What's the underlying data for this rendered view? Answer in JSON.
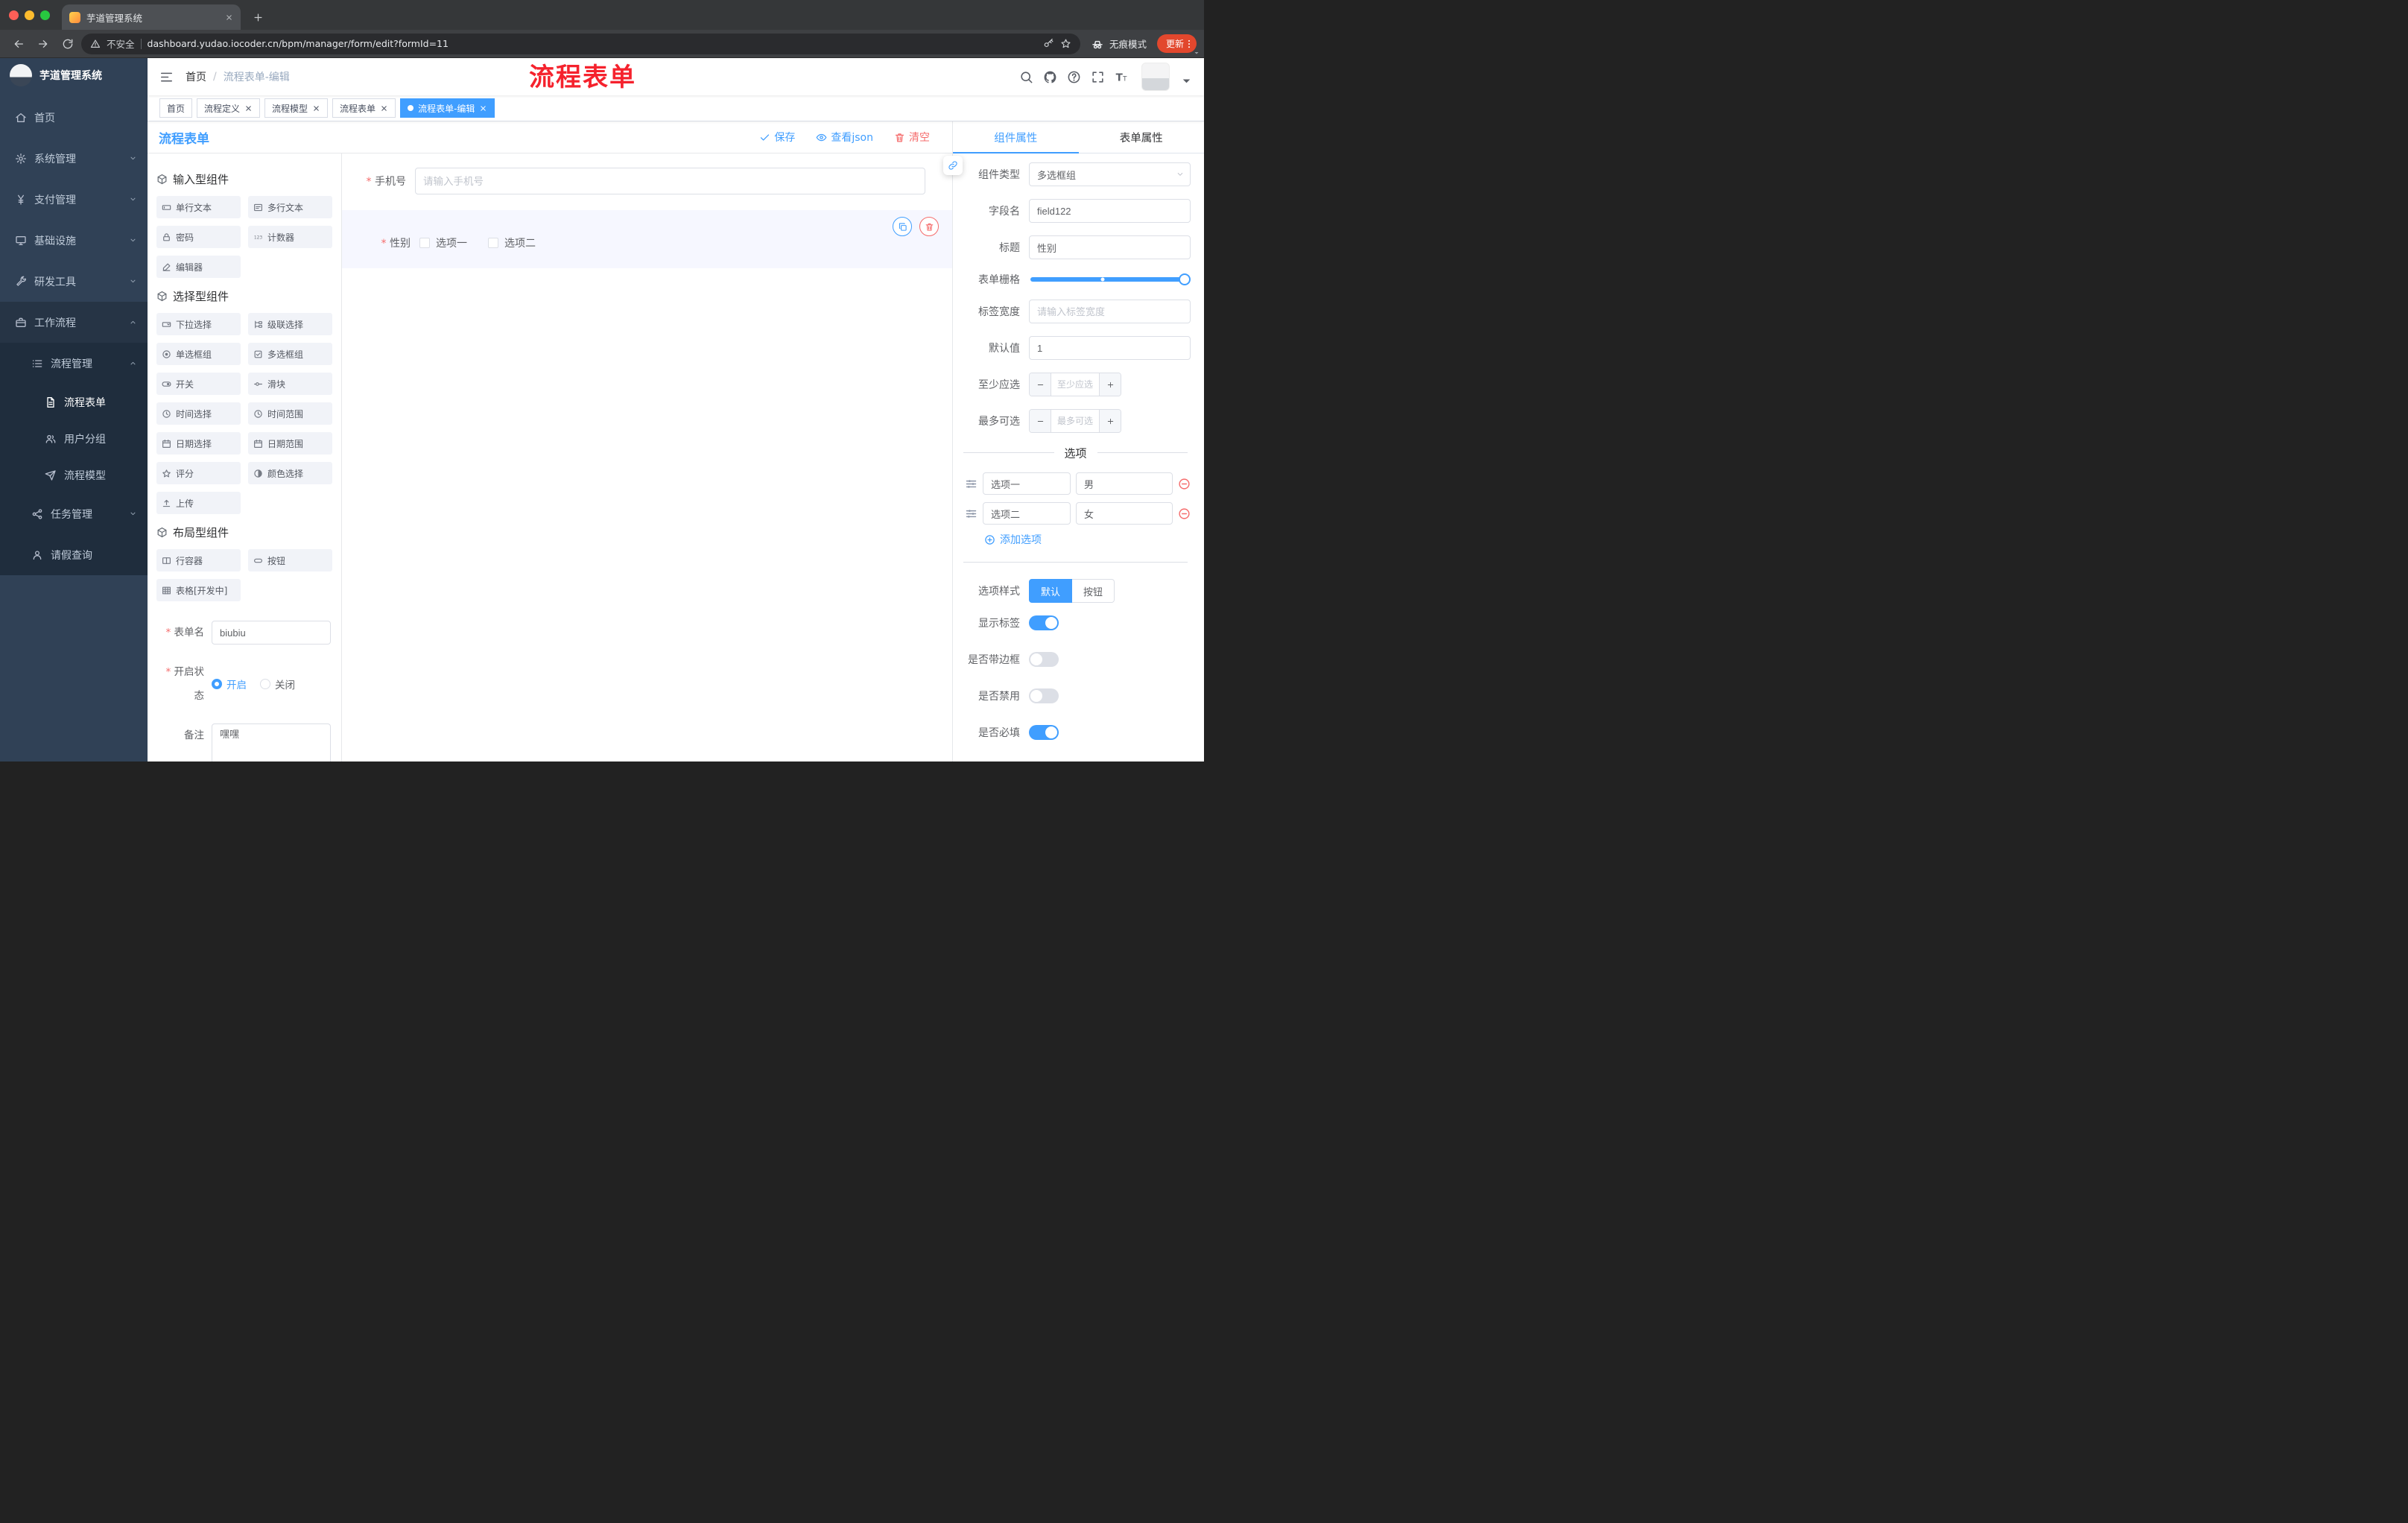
{
  "theme": {
    "accent": "#409eff",
    "danger": "#f56c6c",
    "annotation": "#f5222d",
    "sidebar-bg": "#304156",
    "submenu-bg": "#1f2d3d",
    "submenu-open-bg": "#263445",
    "selected-bg": "#f6f7ff",
    "update-btn": "#e2472d",
    "tab-active-bg": "#4d5054"
  },
  "annotation": {
    "text": "流程表单"
  },
  "browser": {
    "tab_title": "芋道管理系统",
    "security_label": "不安全",
    "url": "dashboard.yudao.iocoder.cn/bpm/manager/form/edit?formId=11",
    "incognito_label": "无痕模式",
    "update_button": "更新"
  },
  "sidebar": {
    "logo_title": "芋道管理系统",
    "menu": [
      {
        "name": "home",
        "label": "首页",
        "icon": "home",
        "level": 1
      },
      {
        "name": "system",
        "label": "系统管理",
        "icon": "gear",
        "level": 1,
        "chevron": "down"
      },
      {
        "name": "payment",
        "label": "支付管理",
        "icon": "yen",
        "level": 1,
        "chevron": "down"
      },
      {
        "name": "infrastructure",
        "label": "基础设施",
        "icon": "monitor",
        "level": 1,
        "chevron": "down"
      },
      {
        "name": "devtools",
        "label": "研发工具",
        "icon": "tools",
        "level": 1,
        "chevron": "down"
      },
      {
        "name": "workflow",
        "label": "工作流程",
        "icon": "briefcase",
        "level": 1,
        "chevron": "up",
        "opened": true
      },
      {
        "name": "process-mgmt",
        "label": "流程管理",
        "icon": "list",
        "level": 2,
        "chevron": "up",
        "sub": true
      },
      {
        "name": "process-form",
        "label": "流程表单",
        "icon": "document",
        "level": 3,
        "sub": true,
        "active": true
      },
      {
        "name": "user-group",
        "label": "用户分组",
        "icon": "users",
        "level": 3,
        "sub": true
      },
      {
        "name": "process-model",
        "label": "流程模型",
        "icon": "send",
        "level": 3,
        "sub": true
      },
      {
        "name": "task-mgmt",
        "label": "任务管理",
        "icon": "share",
        "level": 2,
        "chevron": "down",
        "sub": true
      },
      {
        "name": "leave-query",
        "label": "请假查询",
        "icon": "user",
        "level": 2,
        "sub": true
      }
    ]
  },
  "header": {
    "breadcrumb": [
      "首页",
      "流程表单-编辑"
    ],
    "separator": "/"
  },
  "tags_view": [
    {
      "label": "首页",
      "closable": false,
      "active": false
    },
    {
      "label": "流程定义",
      "closable": true,
      "active": false
    },
    {
      "label": "流程模型",
      "closable": true,
      "active": false
    },
    {
      "label": "流程表单",
      "closable": true,
      "active": false
    },
    {
      "label": "流程表单-编辑",
      "closable": true,
      "active": true
    }
  ],
  "editor": {
    "panel_title": "流程表单",
    "actions": {
      "save": "保存",
      "view_json": "查看json",
      "clear": "清空"
    }
  },
  "component_library": {
    "groups": [
      {
        "title": "输入型组件",
        "icon": "cube",
        "items": [
          {
            "name": "single-line-text",
            "label": "单行文本",
            "icon": "input"
          },
          {
            "name": "multi-line-text",
            "label": "多行文本",
            "icon": "textarea"
          },
          {
            "name": "password",
            "label": "密码",
            "icon": "lock"
          },
          {
            "name": "counter",
            "label": "计数器",
            "icon": "counter"
          },
          {
            "name": "editor",
            "label": "编辑器",
            "icon": "editor"
          }
        ]
      },
      {
        "title": "选择型组件",
        "icon": "cube",
        "items": [
          {
            "name": "dropdown-select",
            "label": "下拉选择",
            "icon": "select"
          },
          {
            "name": "cascade-select",
            "label": "级联选择",
            "icon": "cascade"
          },
          {
            "name": "radio-group",
            "label": "单选框组",
            "icon": "radio"
          },
          {
            "name": "checkbox-group",
            "label": "多选框组",
            "icon": "checkbox"
          },
          {
            "name": "switch",
            "label": "开关",
            "icon": "switch"
          },
          {
            "name": "slider",
            "label": "滑块",
            "icon": "slider"
          },
          {
            "name": "time-picker",
            "label": "时间选择",
            "icon": "time"
          },
          {
            "name": "time-range",
            "label": "时间范围",
            "icon": "time"
          },
          {
            "name": "date-picker",
            "label": "日期选择",
            "icon": "date"
          },
          {
            "name": "date-range",
            "label": "日期范围",
            "icon": "date"
          },
          {
            "name": "rate",
            "label": "评分",
            "icon": "star"
          },
          {
            "name": "color-picker",
            "label": "颜色选择",
            "icon": "color"
          },
          {
            "name": "upload",
            "label": "上传",
            "icon": "upload"
          }
        ]
      },
      {
        "title": "布局型组件",
        "icon": "cube",
        "items": [
          {
            "name": "row-container",
            "label": "行容器",
            "icon": "row"
          },
          {
            "name": "button",
            "label": "按钮",
            "icon": "button"
          },
          {
            "name": "table-dev",
            "label": "表格[开发中]",
            "icon": "table"
          }
        ]
      }
    ]
  },
  "left_form": {
    "form_name": {
      "label": "表单名",
      "value": "biubiu"
    },
    "status": {
      "label": "开启状态",
      "options": [
        {
          "label": "开启",
          "checked": true
        },
        {
          "label": "关闭",
          "checked": false
        }
      ]
    },
    "remark": {
      "label": "备注",
      "value": "嘿嘿"
    }
  },
  "canvas": {
    "phone_field": {
      "label": "手机号",
      "placeholder": "请输入手机号"
    },
    "gender_field": {
      "label": "性别",
      "options": [
        "选项一",
        "选项二"
      ]
    }
  },
  "properties_panel": {
    "tabs": [
      "组件属性",
      "表单属性"
    ],
    "tabs_active": [
      true,
      false
    ],
    "component_type": {
      "label": "组件类型",
      "value": "多选框组"
    },
    "field_name": {
      "label": "字段名",
      "value": "field122"
    },
    "title": {
      "label": "标题",
      "value": "性别"
    },
    "form_grid": {
      "label": "表单栅格"
    },
    "label_width": {
      "label": "标签宽度",
      "placeholder": "请输入标签宽度"
    },
    "default_value": {
      "label": "默认值",
      "value": "1"
    },
    "min_select": {
      "label": "至少应选",
      "placeholder": "至少应选"
    },
    "max_select": {
      "label": "最多可选",
      "placeholder": "最多可选"
    },
    "options_section_title": "选项",
    "options": [
      {
        "label": "选项一",
        "value": "男"
      },
      {
        "label": "选项二",
        "value": "女"
      }
    ],
    "add_option_label": "添加选项",
    "option_style": {
      "label": "选项样式",
      "choices": [
        "默认",
        "按钮"
      ],
      "active": [
        true,
        false
      ]
    },
    "show_label": {
      "label": "显示标签",
      "value": true
    },
    "with_border": {
      "label": "是否带边框",
      "value": false
    },
    "disabled": {
      "label": "是否禁用",
      "value": false
    },
    "required": {
      "label": "是否必填",
      "value": true
    }
  }
}
